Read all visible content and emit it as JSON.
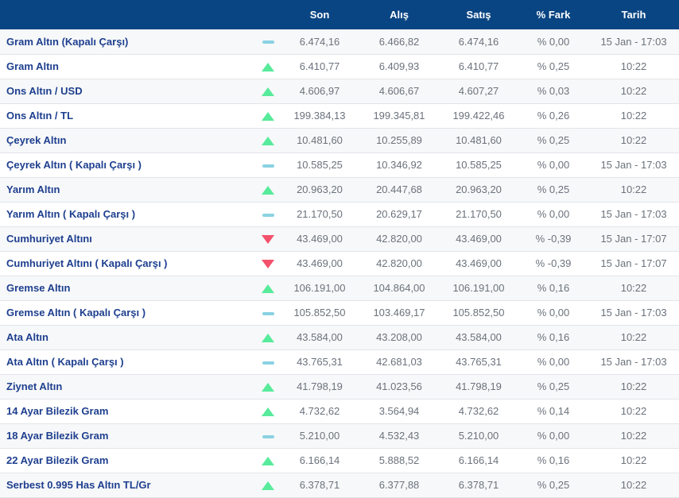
{
  "colors": {
    "header_bg": "#0a4583",
    "header_text": "#ffffff",
    "name_text": "#1e3f8f",
    "value_text": "#6b727c",
    "row_bg": "#ffffff",
    "row_alt_bg": "#f7f8f9",
    "divider": "#e2e5e9",
    "up": "#57eb9b",
    "down": "#f4516c",
    "flat": "#8ad2e2"
  },
  "icons": {
    "up": "triangle-up-icon",
    "down": "triangle-down-icon",
    "flat": "dash-icon"
  },
  "table": {
    "headers": {
      "son": "Son",
      "alis": "Alış",
      "satis": "Satış",
      "fark": "% Fark",
      "tarih": "Tarih"
    },
    "rows": [
      {
        "name": "Gram Altın (Kapalı Çarşı)",
        "trend": "flat",
        "son": "6.474,16",
        "alis": "6.466,82",
        "satis": "6.474,16",
        "fark": "% 0,00",
        "tarih": "15 Jan - 17:03"
      },
      {
        "name": "Gram Altın",
        "trend": "up",
        "son": "6.410,77",
        "alis": "6.409,93",
        "satis": "6.410,77",
        "fark": "% 0,25",
        "tarih": "10:22"
      },
      {
        "name": "Ons Altın / USD",
        "trend": "up",
        "son": "4.606,97",
        "alis": "4.606,67",
        "satis": "4.607,27",
        "fark": "% 0,03",
        "tarih": "10:22"
      },
      {
        "name": "Ons Altın / TL",
        "trend": "up",
        "son": "199.384,13",
        "alis": "199.345,81",
        "satis": "199.422,46",
        "fark": "% 0,26",
        "tarih": "10:22"
      },
      {
        "name": "Çeyrek Altın",
        "trend": "up",
        "son": "10.481,60",
        "alis": "10.255,89",
        "satis": "10.481,60",
        "fark": "% 0,25",
        "tarih": "10:22"
      },
      {
        "name": "Çeyrek Altın ( Kapalı Çarşı )",
        "trend": "flat",
        "son": "10.585,25",
        "alis": "10.346,92",
        "satis": "10.585,25",
        "fark": "% 0,00",
        "tarih": "15 Jan - 17:03"
      },
      {
        "name": "Yarım Altın",
        "trend": "up",
        "son": "20.963,20",
        "alis": "20.447,68",
        "satis": "20.963,20",
        "fark": "% 0,25",
        "tarih": "10:22"
      },
      {
        "name": "Yarım Altın ( Kapalı Çarşı )",
        "trend": "flat",
        "son": "21.170,50",
        "alis": "20.629,17",
        "satis": "21.170,50",
        "fark": "% 0,00",
        "tarih": "15 Jan - 17:03"
      },
      {
        "name": "Cumhuriyet Altını",
        "trend": "down",
        "son": "43.469,00",
        "alis": "42.820,00",
        "satis": "43.469,00",
        "fark": "% -0,39",
        "tarih": "15 Jan - 17:07"
      },
      {
        "name": "Cumhuriyet Altını ( Kapalı Çarşı )",
        "trend": "down",
        "son": "43.469,00",
        "alis": "42.820,00",
        "satis": "43.469,00",
        "fark": "% -0,39",
        "tarih": "15 Jan - 17:07"
      },
      {
        "name": "Gremse Altın",
        "trend": "up",
        "son": "106.191,00",
        "alis": "104.864,00",
        "satis": "106.191,00",
        "fark": "% 0,16",
        "tarih": "10:22"
      },
      {
        "name": "Gremse Altın ( Kapalı Çarşı )",
        "trend": "flat",
        "son": "105.852,50",
        "alis": "103.469,17",
        "satis": "105.852,50",
        "fark": "% 0,00",
        "tarih": "15 Jan - 17:03"
      },
      {
        "name": "Ata Altın",
        "trend": "up",
        "son": "43.584,00",
        "alis": "43.208,00",
        "satis": "43.584,00",
        "fark": "% 0,16",
        "tarih": "10:22"
      },
      {
        "name": "Ata Altın ( Kapalı Çarşı )",
        "trend": "flat",
        "son": "43.765,31",
        "alis": "42.681,03",
        "satis": "43.765,31",
        "fark": "% 0,00",
        "tarih": "15 Jan - 17:03"
      },
      {
        "name": "Ziynet Altın",
        "trend": "up",
        "son": "41.798,19",
        "alis": "41.023,56",
        "satis": "41.798,19",
        "fark": "% 0,25",
        "tarih": "10:22"
      },
      {
        "name": "14 Ayar Bilezik Gram",
        "trend": "up",
        "son": "4.732,62",
        "alis": "3.564,94",
        "satis": "4.732,62",
        "fark": "% 0,14",
        "tarih": "10:22"
      },
      {
        "name": "18 Ayar Bilezik Gram",
        "trend": "flat",
        "son": "5.210,00",
        "alis": "4.532,43",
        "satis": "5.210,00",
        "fark": "% 0,00",
        "tarih": "10:22"
      },
      {
        "name": "22 Ayar Bilezik Gram",
        "trend": "up",
        "son": "6.166,14",
        "alis": "5.888,52",
        "satis": "6.166,14",
        "fark": "% 0,16",
        "tarih": "10:22"
      },
      {
        "name": "Serbest 0.995 Has Altın TL/Gr",
        "trend": "up",
        "son": "6.378,71",
        "alis": "6.377,88",
        "satis": "6.378,71",
        "fark": "% 0,25",
        "tarih": "10:22"
      }
    ]
  }
}
